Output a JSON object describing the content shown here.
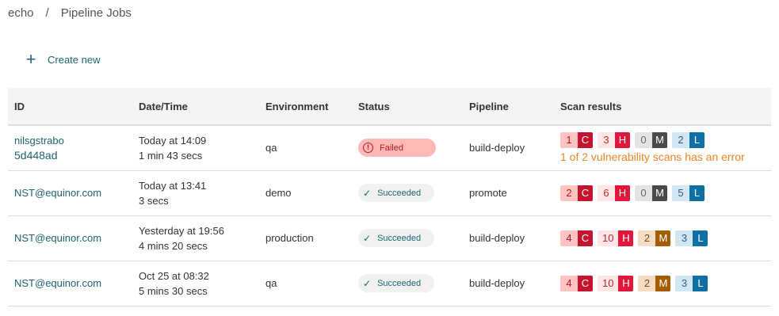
{
  "breadcrumb": {
    "root": "echo",
    "separator": "/",
    "current": "Pipeline Jobs"
  },
  "actions": {
    "create_label": "Create new"
  },
  "table": {
    "headers": {
      "id": "ID",
      "datetime": "Date/Time",
      "environment": "Environment",
      "status": "Status",
      "pipeline": "Pipeline",
      "scan": "Scan results"
    },
    "rows": [
      {
        "user": "nilsgstrabo",
        "hash": "5d448ad",
        "date": "Today at 14:09",
        "duration": "1 min 43 secs",
        "environment": "qa",
        "status": "Failed",
        "pipeline": "build-deploy",
        "scan": {
          "critical": "1",
          "high": "3",
          "medium": "0",
          "low": "2",
          "error": "1 of 2 vulnerability scans has an error"
        }
      },
      {
        "user": "NST@equinor.com",
        "date": "Today at 13:41",
        "duration": "3 secs",
        "environment": "demo",
        "status": "Succeeded",
        "pipeline": "promote",
        "scan": {
          "critical": "2",
          "high": "6",
          "medium": "0",
          "low": "5"
        }
      },
      {
        "user": "NST@equinor.com",
        "date": "Yesterday at 19:56",
        "duration": "4 mins 20 secs",
        "environment": "production",
        "status": "Succeeded",
        "pipeline": "build-deploy",
        "scan": {
          "critical": "4",
          "high": "10",
          "medium": "2",
          "low": "3"
        }
      },
      {
        "user": "NST@equinor.com",
        "date": "Oct 25 at 08:32",
        "duration": "5 mins 30 secs",
        "environment": "qa",
        "status": "Succeeded",
        "pipeline": "build-deploy",
        "scan": {
          "critical": "4",
          "high": "10",
          "medium": "2",
          "low": "3"
        }
      }
    ],
    "severity_letters": {
      "critical": "C",
      "high": "H",
      "medium": "M",
      "low": "L"
    }
  }
}
